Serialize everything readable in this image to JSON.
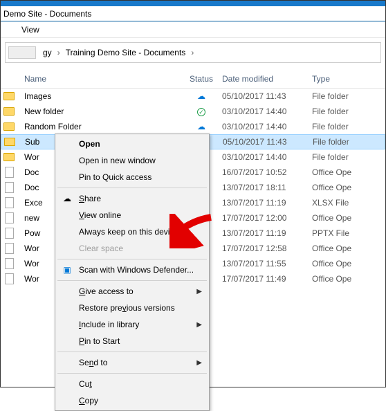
{
  "window": {
    "title": "Demo Site - Documents"
  },
  "menubar": {
    "view": "View"
  },
  "breadcrumb": {
    "parent_fragment": "gy",
    "current": "Training Demo Site - Documents"
  },
  "columns": {
    "name": "Name",
    "status": "Status",
    "date": "Date modified",
    "type": "Type"
  },
  "rows": [
    {
      "icon": "folder",
      "name": "Images",
      "status": "cloud",
      "date": "05/10/2017 11:43",
      "type": "File folder"
    },
    {
      "icon": "folder",
      "name": "New folder",
      "status": "check",
      "date": "03/10/2017 14:40",
      "type": "File folder"
    },
    {
      "icon": "folder",
      "name": "Random Folder",
      "status": "cloud",
      "date": "03/10/2017 14:40",
      "type": "File folder"
    },
    {
      "icon": "folder",
      "name": "Sub",
      "status": "",
      "date": "05/10/2017 11:43",
      "type": "File folder",
      "selected": true
    },
    {
      "icon": "folder",
      "name": "Wor",
      "status": "",
      "date": "03/10/2017 14:40",
      "type": "File folder"
    },
    {
      "icon": "file",
      "name": "Doc",
      "status": "",
      "date": "16/07/2017 10:52",
      "type": "Office Ope"
    },
    {
      "icon": "file",
      "name": "Doc",
      "status": "",
      "date": "13/07/2017 18:11",
      "type": "Office Ope"
    },
    {
      "icon": "file",
      "name": "Exce",
      "status": "",
      "date": "13/07/2017 11:19",
      "type": "XLSX File"
    },
    {
      "icon": "file",
      "name": "new",
      "status": "",
      "date": "17/07/2017 12:00",
      "type": "Office Ope"
    },
    {
      "icon": "file",
      "name": "Pow",
      "status": "",
      "date": "13/07/2017 11:19",
      "type": "PPTX File"
    },
    {
      "icon": "file",
      "name": "Wor",
      "status": "",
      "date": "17/07/2017 12:58",
      "type": "Office Ope"
    },
    {
      "icon": "file",
      "name": "Wor",
      "status": "",
      "date": "13/07/2017 11:55",
      "type": "Office Ope"
    },
    {
      "icon": "file",
      "name": "Wor",
      "status": "",
      "date": "17/07/2017 11:49",
      "type": "Office Ope"
    }
  ],
  "context_menu": {
    "open": "Open",
    "open_new_window": "Open in new window",
    "pin_quick_access": "Pin to Quick access",
    "share": "Share",
    "view_online": "View online",
    "always_keep": "Always keep on this device",
    "clear_space": "Clear space",
    "scan_defender": "Scan with Windows Defender...",
    "give_access": "Give access to",
    "restore_previous": "Restore previous versions",
    "include_library": "Include in library",
    "pin_start": "Pin to Start",
    "send_to": "Send to",
    "cut": "Cut",
    "copy": "Copy"
  }
}
